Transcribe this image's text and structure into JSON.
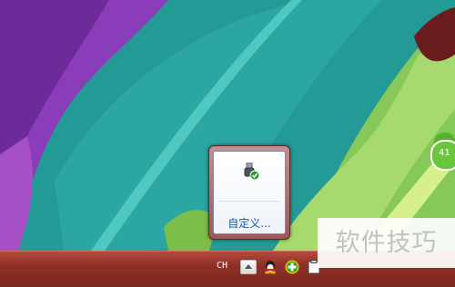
{
  "tray_popup": {
    "customize_label": "自定义..."
  },
  "taskbar": {
    "language_indicator": "CH"
  },
  "desktop_widget": {
    "badge_text": "41"
  },
  "watermark": {
    "text": "软件技巧"
  },
  "icons": {
    "popup": [
      "usb-device-icon"
    ],
    "tray": [
      "show-hidden-icons-arrow",
      "qq-icon",
      "green-plus-icon",
      "clipboard-icon"
    ]
  },
  "colors": {
    "taskbar": "#8e2f25",
    "popup_frame": "#9c5858",
    "link": "#1559a8"
  }
}
